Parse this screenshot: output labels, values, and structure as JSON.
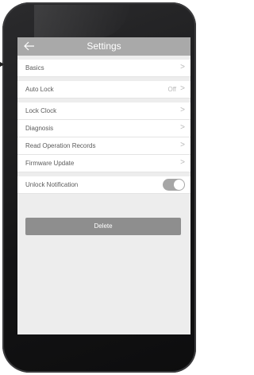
{
  "nav": {
    "title": "Settings",
    "back_icon": "arrow-left-icon"
  },
  "rows": [
    {
      "label": "Basics",
      "chevron": ">"
    },
    {
      "label": "Auto Lock",
      "value": "Off",
      "chevron": ">"
    },
    {
      "label": "Lock Clock",
      "chevron": ">"
    },
    {
      "label": "Diagnosis",
      "chevron": ">"
    },
    {
      "label": "Read Operation Records",
      "chevron": ">"
    },
    {
      "label": "Firmware Update",
      "chevron": ">"
    },
    {
      "label": "Unlock Notification",
      "toggle_on": true
    }
  ],
  "delete_label": "Delete",
  "colors": {
    "navbar": "#a9a9a9",
    "background": "#ededed",
    "toggle": "#a6a6a6",
    "delete_button": "#8e8e8e"
  }
}
